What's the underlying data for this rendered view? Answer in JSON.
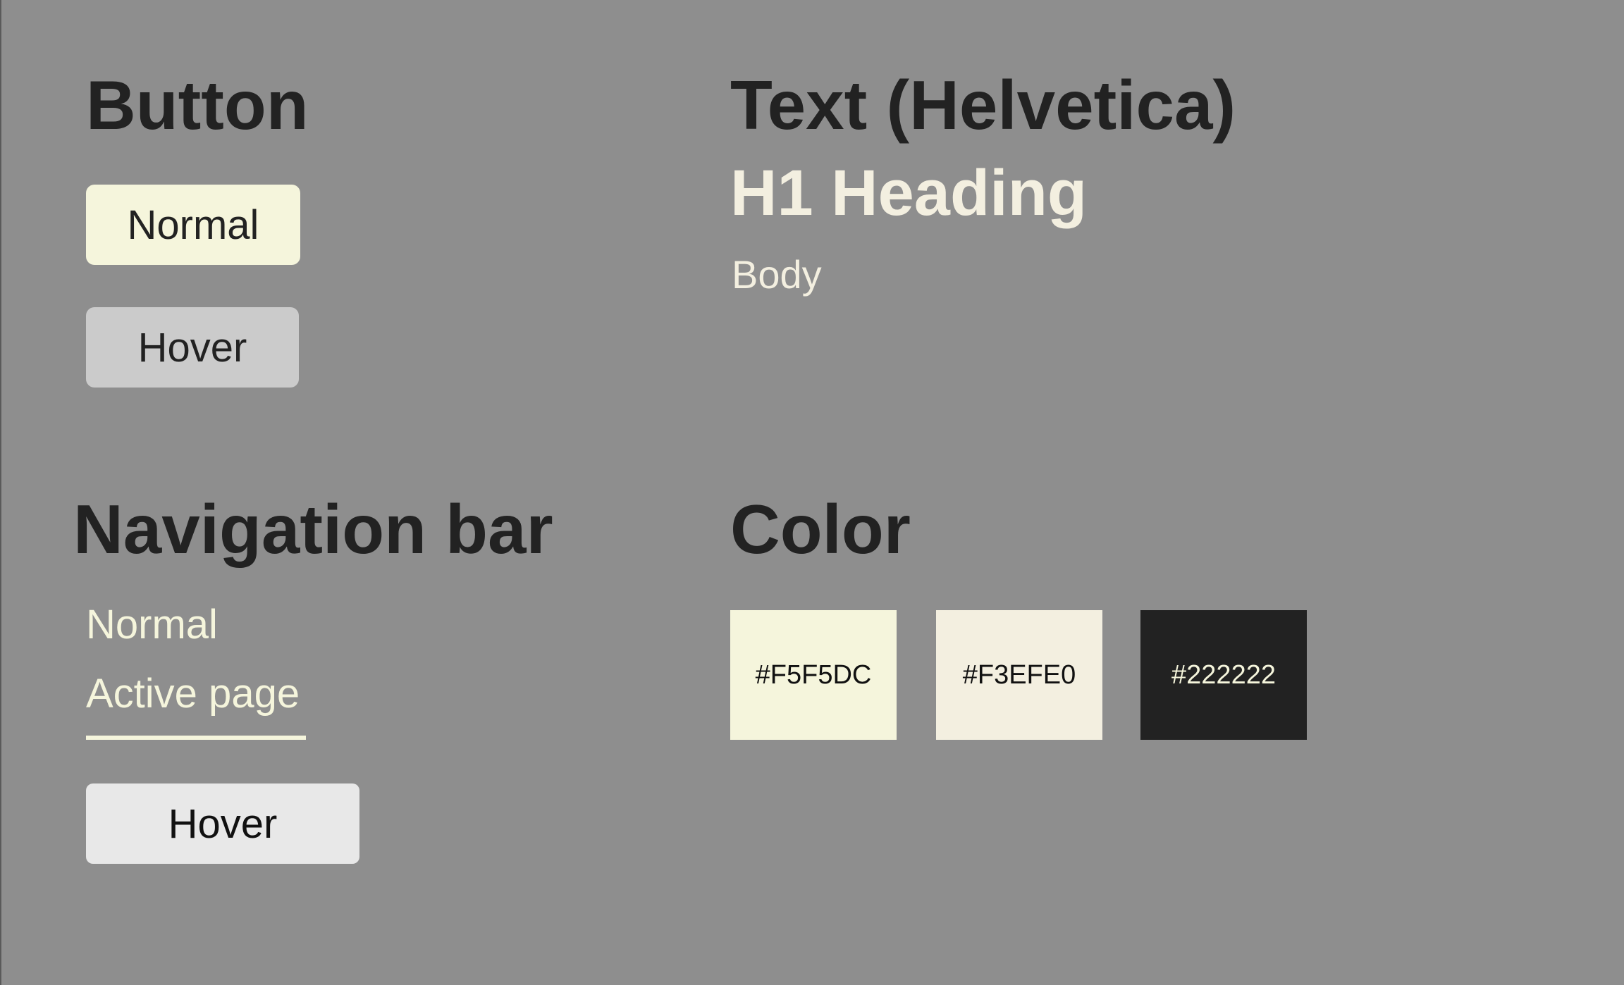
{
  "sections": {
    "button": {
      "title": "Button",
      "normal_label": "Normal",
      "hover_label": "Hover"
    },
    "text": {
      "title": "Text (Helvetica)",
      "h1_sample": "H1 Heading",
      "body_sample": "Body"
    },
    "navigation": {
      "title": "Navigation bar",
      "normal_label": "Normal",
      "active_label": "Active page",
      "hover_label": "Hover"
    },
    "color": {
      "title": "Color",
      "swatches": [
        {
          "hex": "#F5F5DC",
          "value": "#f5f5dc"
        },
        {
          "hex": "#F3EFE0",
          "value": "#f3efe0"
        },
        {
          "hex": "#222222",
          "value": "#222222"
        }
      ]
    }
  },
  "colors": {
    "background": "#8e8e8e",
    "heading": "#222222",
    "button_normal_bg": "#f5f5dc",
    "button_hover_bg": "#cbcbcb",
    "nav_hover_bg": "#e8e8e8"
  }
}
